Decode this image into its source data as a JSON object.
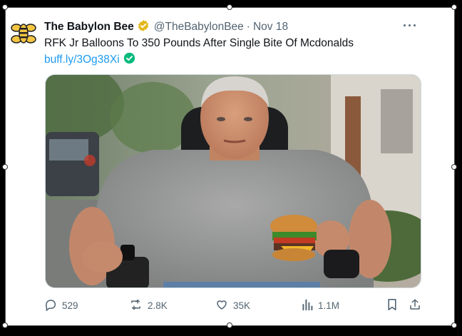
{
  "tweet": {
    "author_name": "The Babylon Bee",
    "author_handle": "@TheBabylonBee",
    "separator": "·",
    "date": "Nov 18",
    "more_label": "···",
    "text": "RFK Jr Balloons To 350 Pounds After Single Bite Of Mcdonalds",
    "link": "buff.ly/3Og38Xi"
  },
  "actions": {
    "replies": "529",
    "reposts": "2.8K",
    "likes": "35K",
    "views": "1.1M"
  },
  "icons": {
    "avatar": "bee-logo-icon",
    "verified": "gold-verified-badge-icon",
    "link_check": "green-check-icon",
    "reply": "reply-icon",
    "repost": "repost-icon",
    "like": "heart-icon",
    "views": "views-chart-icon",
    "bookmark": "bookmark-icon",
    "share": "share-icon"
  },
  "colors": {
    "link": "#1d9bf0",
    "verified_gold": "#e2b719",
    "check_green": "#00ba7c",
    "muted": "#536471"
  }
}
